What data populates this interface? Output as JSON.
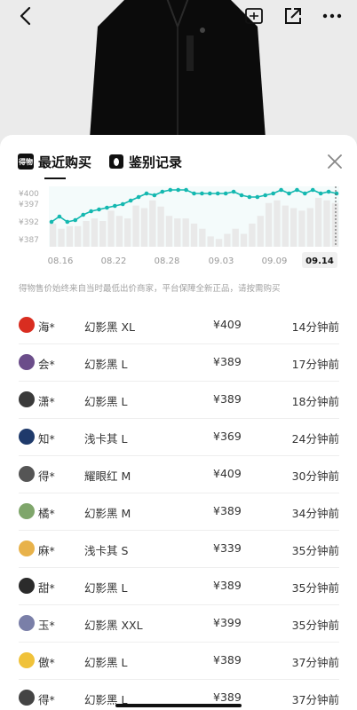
{
  "header": {
    "icons": [
      "back-arrow-icon",
      "sell-icon",
      "share-icon",
      "more-icon"
    ]
  },
  "tabs": [
    {
      "label": "最近购买",
      "icon": "dewu-logo-icon",
      "logo_text": "得物"
    },
    {
      "label": "鉴别记录",
      "icon": "identify-icon"
    }
  ],
  "chart_data": {
    "type": "line",
    "x_ticks": [
      "08.16",
      "08.22",
      "08.28",
      "09.03",
      "09.09",
      "09.14"
    ],
    "y_ticks": [
      "¥397",
      "¥392",
      "¥387"
    ],
    "y_ticks_partial": [
      "¥400"
    ],
    "selected_x": "09.14",
    "line_points": [
      392,
      393.5,
      392,
      392.5,
      394,
      395,
      395.5,
      396,
      396.5,
      397,
      398,
      399,
      400,
      399.5,
      400.5,
      401,
      401,
      401,
      400,
      400,
      400,
      400,
      400,
      400.5,
      399.5,
      399,
      399,
      399.5,
      400,
      401,
      400,
      401,
      400,
      401,
      400,
      400.5,
      400
    ],
    "bar_values": [
      0.45,
      0.35,
      0.4,
      0.4,
      0.5,
      0.55,
      0.5,
      0.7,
      0.6,
      0.55,
      0.8,
      0.75,
      0.9,
      0.78,
      0.6,
      0.55,
      0.55,
      0.45,
      0.35,
      0.2,
      0.15,
      0.25,
      0.35,
      0.25,
      0.45,
      0.6,
      0.85,
      0.9,
      0.8,
      0.75,
      0.7,
      0.75,
      0.95,
      0.9,
      0.85
    ]
  },
  "disclaimer": "得物售价始终来自当时最低出价商家，平台保障全新正品，请按需购买",
  "purchases": [
    {
      "name": "海*",
      "variant": "幻影黑 XL",
      "price": "¥409",
      "time": "14分钟前",
      "avatar_color": "#d92d20"
    },
    {
      "name": "会*",
      "variant": "幻影黑 L",
      "price": "¥389",
      "time": "17分钟前",
      "avatar_color": "#6b4d8a"
    },
    {
      "name": "潇*",
      "variant": "幻影黑 L",
      "price": "¥389",
      "time": "18分钟前",
      "avatar_color": "#3a3a3a"
    },
    {
      "name": "知*",
      "variant": "浅卡其 L",
      "price": "¥369",
      "time": "24分钟前",
      "avatar_color": "#1f3a6b"
    },
    {
      "name": "得*",
      "variant": "耀眼红 M",
      "price": "¥409",
      "time": "30分钟前",
      "avatar_color": "#555555"
    },
    {
      "name": "橘*",
      "variant": "幻影黑 M",
      "price": "¥389",
      "time": "34分钟前",
      "avatar_color": "#7fa66b"
    },
    {
      "name": "麻*",
      "variant": "浅卡其 S",
      "price": "¥339",
      "time": "35分钟前",
      "avatar_color": "#e8b24a"
    },
    {
      "name": "甜*",
      "variant": "幻影黑 L",
      "price": "¥389",
      "time": "35分钟前",
      "avatar_color": "#2b2b2b"
    },
    {
      "name": "玉*",
      "variant": "幻影黑 XXL",
      "price": "¥399",
      "time": "35分钟前",
      "avatar_color": "#7a7fa8"
    },
    {
      "name": "傲*",
      "variant": "幻影黑 L",
      "price": "¥389",
      "time": "37分钟前",
      "avatar_color": "#f0c23a"
    },
    {
      "name": "得*",
      "variant": "幻影黑 L",
      "price": "¥389",
      "time": "37分钟前",
      "avatar_color": "#444444"
    }
  ]
}
